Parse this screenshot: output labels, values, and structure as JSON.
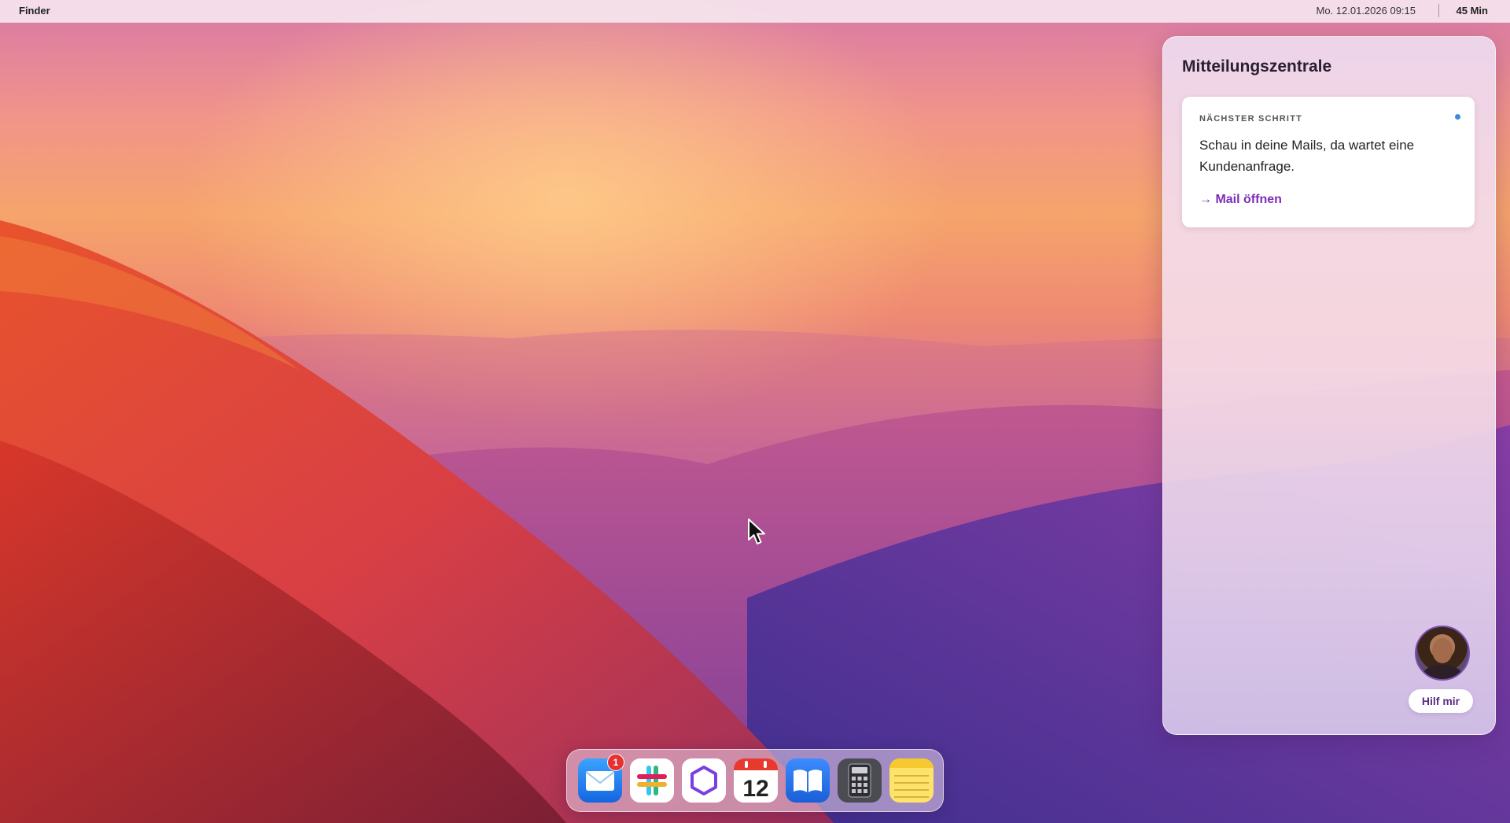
{
  "menubar": {
    "app_name": "Finder",
    "datetime": "Mo. 12.01.2026 09:15",
    "timer": "45 Min"
  },
  "notification_center": {
    "title": "Mitteilungszentrale",
    "card": {
      "label": "NÄCHSTER SCHRITT",
      "text": "Schau in deine Mails, da wartet eine Kundenanfrage.",
      "link": "→ Mail öffnen",
      "unread_color": "#3d8be0"
    },
    "help_button": "Hilf mir"
  },
  "dock": {
    "items": [
      {
        "name": "mail-icon",
        "badge": "1"
      },
      {
        "name": "slack-icon"
      },
      {
        "name": "hexagon-app-icon"
      },
      {
        "name": "calendar-icon",
        "day": "12"
      },
      {
        "name": "books-icon"
      },
      {
        "name": "calculator-icon"
      },
      {
        "name": "notes-icon"
      }
    ]
  },
  "colors": {
    "accent_link": "#7b2db8",
    "badge": "#e5312f"
  }
}
